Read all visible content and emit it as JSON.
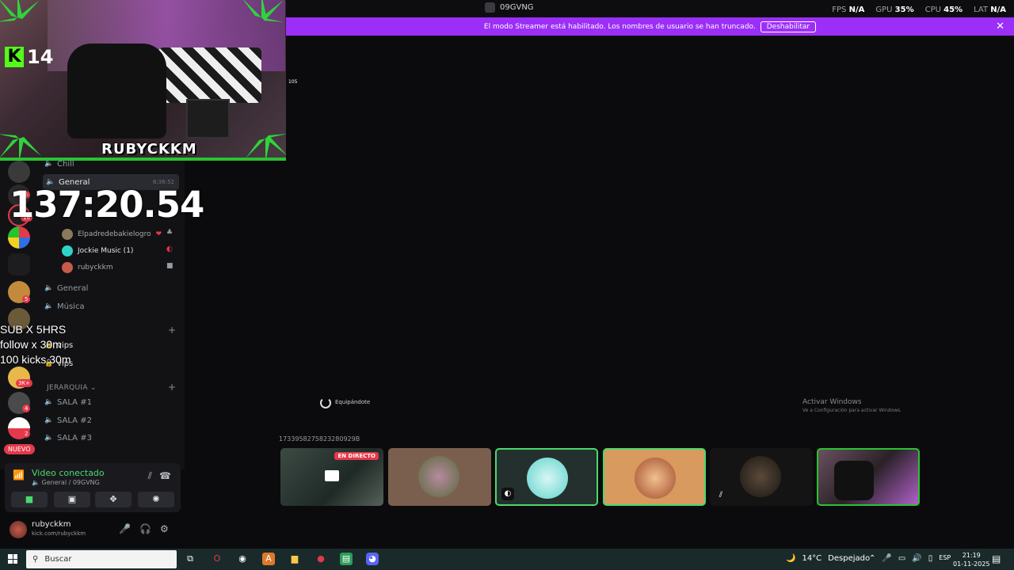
{
  "window": {
    "title": "09GVNG"
  },
  "perf": [
    {
      "label": "FPS",
      "value": "N/A"
    },
    {
      "label": "GPU",
      "value": "35%"
    },
    {
      "label": "CPU",
      "value": "45%"
    },
    {
      "label": "LAT",
      "value": "N/A"
    }
  ],
  "banner": {
    "text": "El modo Streamer está habilitado. Los nombres de usuario se han truncado.",
    "button": "Deshabilitar"
  },
  "webcam": {
    "kick_count": "14",
    "streamer_name": "RUBYCKKM",
    "small_label": "105"
  },
  "overlay": {
    "timer": "137:20.54",
    "sub_line1": "SUB X 5HRS",
    "sub_line2": "follow x 30m",
    "sub_line3": "100 kicks 30m"
  },
  "rail": {
    "badges": [
      "5",
      "18",
      "5",
      "3K+",
      "4",
      "2"
    ],
    "new_label": "NUEVO",
    "live_label": "EN DIRECTO"
  },
  "channels": {
    "chill": "Chill",
    "general_active": "General",
    "general_time": "6:36:52",
    "users": [
      {
        "name": "Elpadredebakielogro"
      },
      {
        "name": "Jockie Music (1)"
      },
      {
        "name": "rubyckkm"
      }
    ],
    "general2": "General",
    "musica": "Música",
    "vips1": "vips",
    "vips2": "vips",
    "category_jerarquia": "JERARQUIA",
    "sala1": "SALA #1",
    "sala2": "SALA #2",
    "sala3": "SALA #3"
  },
  "voice": {
    "status": "Video conectado",
    "location": "General / 09GVNG"
  },
  "user": {
    "name": "rubyckkm",
    "status": "kick.com/rubyckkm"
  },
  "stage": {
    "loading": "Equipándote",
    "activate_title": "Activar Windows",
    "activate_sub": "Ve a Configuración para activar Windows.",
    "stream_id": "1733958275823280929B",
    "live_badge": "EN DIRECTO"
  },
  "taskbar": {
    "search": "Buscar",
    "weather": "14°C",
    "weather_desc": "Despejado",
    "lang": "ESP",
    "time": "21:19",
    "date": "01-11-2025"
  },
  "colors": {
    "accent": "#9b2ff7",
    "green": "#27c431",
    "red": "#e4394a"
  }
}
